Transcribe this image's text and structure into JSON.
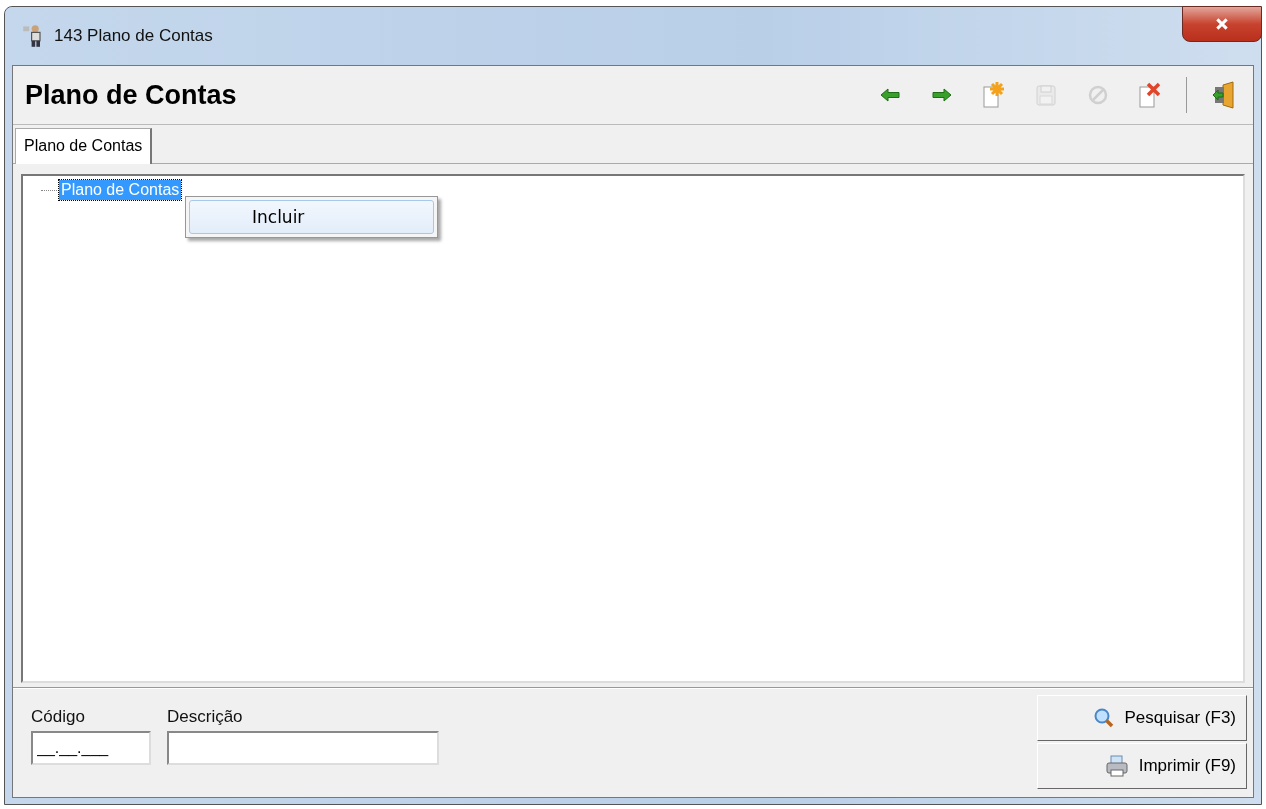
{
  "window": {
    "title": "143 Plano de Contas"
  },
  "header": {
    "title": "Plano de Contas"
  },
  "toolbar": [
    {
      "kind": "back",
      "disabled": false
    },
    {
      "kind": "forward",
      "disabled": false
    },
    {
      "kind": "new",
      "disabled": false
    },
    {
      "kind": "save",
      "disabled": true
    },
    {
      "kind": "cancel",
      "disabled": true
    },
    {
      "kind": "delete",
      "disabled": false
    },
    {
      "kind": "separator"
    },
    {
      "kind": "exit",
      "disabled": false
    }
  ],
  "tabs": [
    {
      "label": "Plano de Contas",
      "selected": true
    }
  ],
  "tree": [
    {
      "label": "Plano de Contas",
      "selected": true
    }
  ],
  "context_menu": {
    "items": [
      "Incluir"
    ]
  },
  "filters": [
    {
      "label": "Código",
      "value": "__.__.___"
    },
    {
      "label": "Descrição"
    }
  ],
  "buttons": [
    {
      "kind": "search",
      "label": "Pesquisar (F3)"
    },
    {
      "kind": "print",
      "label": "Imprimir (F9)"
    }
  ]
}
